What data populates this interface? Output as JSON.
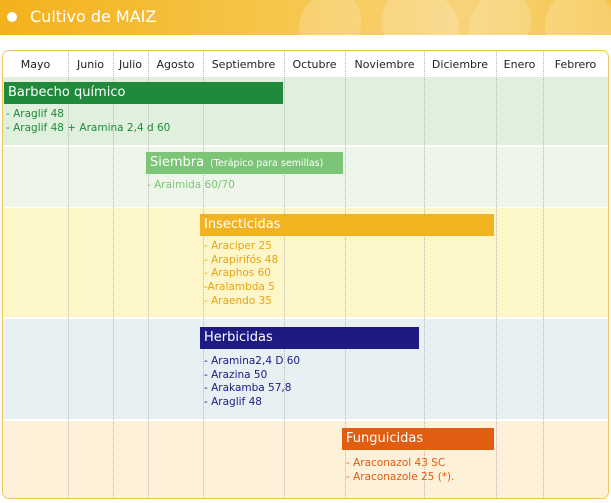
{
  "header": {
    "title": "Cultivo de MAIZ"
  },
  "months": [
    "Mayo",
    "Junio",
    "Julio",
    "Agosto",
    "Septiembre",
    "Octubre",
    "Noviembre",
    "Diciembre",
    "Enero",
    "Febrero"
  ],
  "colors": {
    "header_gold": "#f3b21c",
    "frame_border": "#f1c35e",
    "barbecho": "#1f8a3a",
    "siembra": "#7cc576",
    "insecticidas": "#f2b320",
    "herbicidas": "#1d1a83",
    "funguicidas": "#e05d11"
  },
  "sections": [
    {
      "id": "barbecho",
      "label": "Barbecho químico",
      "items": [
        "- Araglif 48",
        "- Araglif 48 + Aramina 2,4 d 60"
      ]
    },
    {
      "id": "siembra",
      "label": "Siembra",
      "sublabel": "(Terápico para semillas)",
      "items": [
        "- Araimida 60/70"
      ]
    },
    {
      "id": "insecticidas",
      "label": "Insecticidas",
      "items": [
        "- Araciper 25",
        "- Arapirifós 48",
        "- Araphos 60",
        "-Aralambda 5",
        "- Araendo 35"
      ]
    },
    {
      "id": "herbicidas",
      "label": "Herbicidas",
      "items": [
        "- Aramina2,4 D 60",
        "- Arazina 50",
        "- Arakamba 57,8",
        "- Araglif 48"
      ]
    },
    {
      "id": "funguicidas",
      "label": "Funguicidas",
      "items": [
        "- Araconazol 43 SC",
        "- Araconazole 25 (*)."
      ]
    }
  ]
}
